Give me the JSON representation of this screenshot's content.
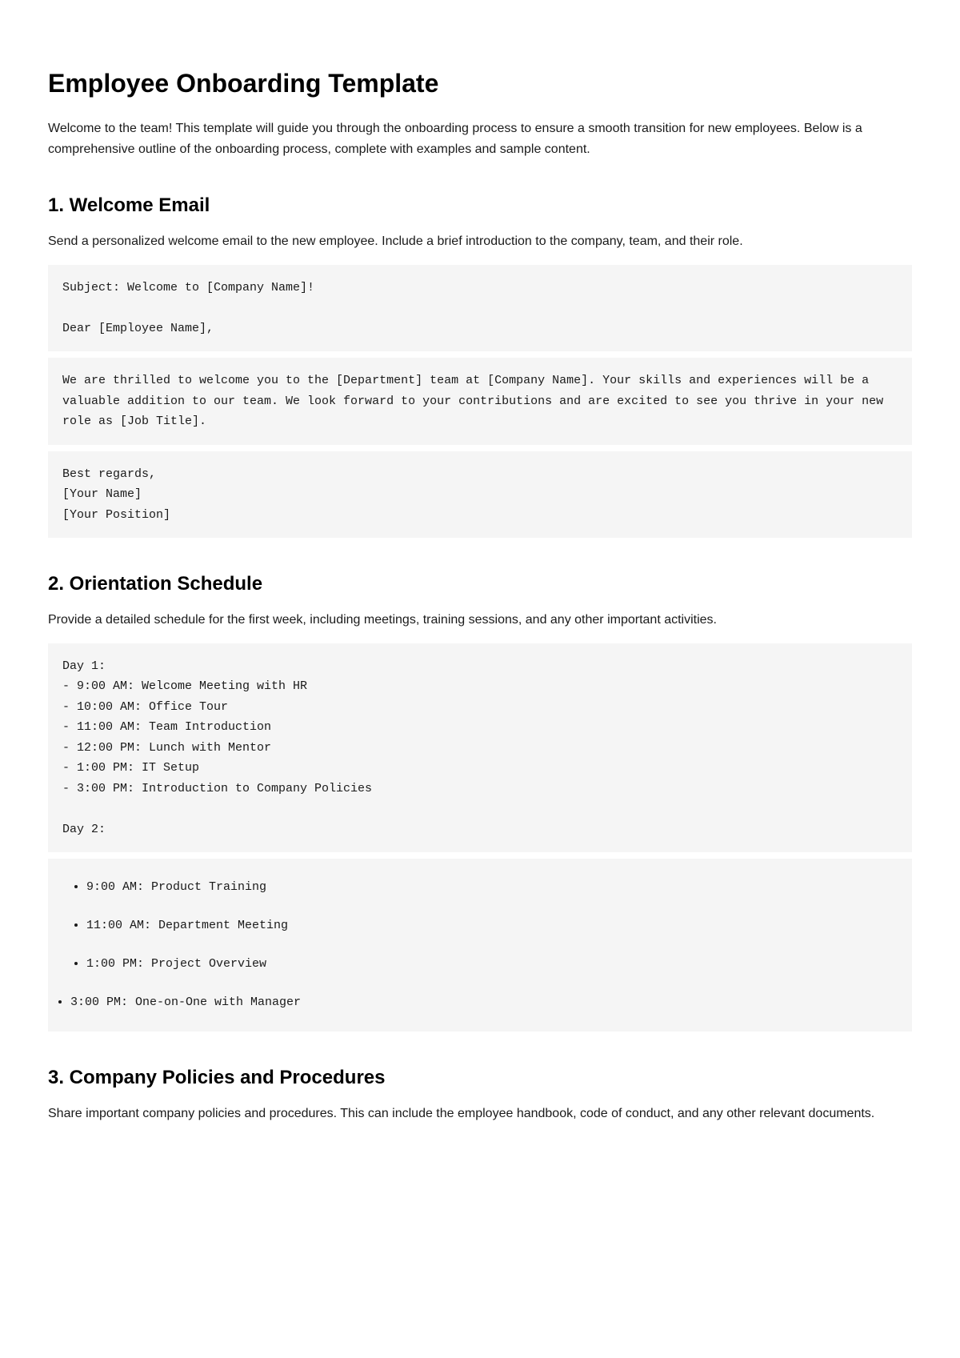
{
  "title": "Employee Onboarding Template",
  "intro": "Welcome to the team! This template will guide you through the onboarding process to ensure a smooth transition for new employees. Below is a comprehensive outline of the onboarding process, complete with examples and sample content.",
  "section1": {
    "heading": "1. Welcome Email",
    "desc": "Send a personalized welcome email to the new employee. Include a brief introduction to the company, team, and their role.",
    "block1": "Subject: Welcome to [Company Name]!\n\nDear [Employee Name],",
    "block2": "We are thrilled to welcome you to the [Department] team at [Company Name]. Your skills and experiences will be a valuable addition to our team. We look forward to your contributions and are excited to see you thrive in your new role as [Job Title].",
    "block3": "Best regards,\n[Your Name]\n[Your Position]"
  },
  "section2": {
    "heading": "2. Orientation Schedule",
    "desc": "Provide a detailed schedule for the first week, including meetings, training sessions, and any other important activities.",
    "block1": "Day 1:\n- 9:00 AM: Welcome Meeting with HR\n- 10:00 AM: Office Tour\n- 11:00 AM: Team Introduction\n- 12:00 PM: Lunch with Mentor\n- 1:00 PM: IT Setup\n- 3:00 PM: Introduction to Company Policies\n\nDay 2:",
    "day2_items": {
      "i0": "9:00 AM: Product Training",
      "i1": "11:00 AM: Department Meeting",
      "i2": "1:00 PM: Project Overview",
      "i3": "3:00 PM: One-on-One with Manager"
    }
  },
  "section3": {
    "heading": "3. Company Policies and Procedures",
    "desc": "Share important company policies and procedures. This can include the employee handbook, code of conduct, and any other relevant documents."
  }
}
